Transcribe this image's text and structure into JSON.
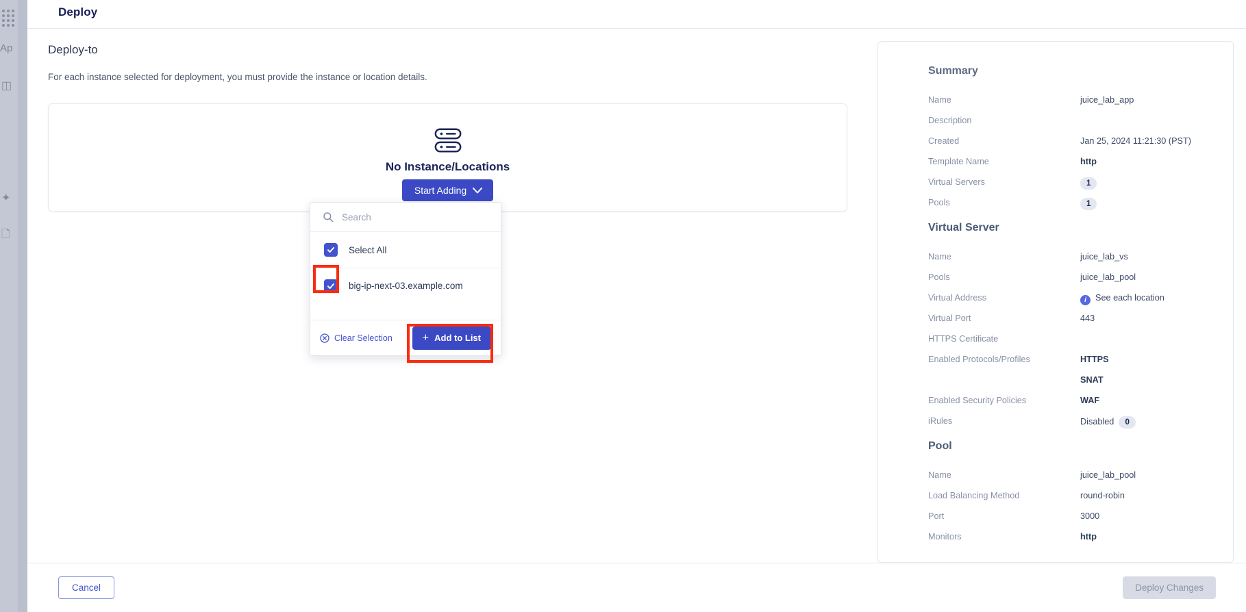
{
  "background": {
    "app_label": "Ap",
    "icons": [
      "grid-dots-icon",
      "cubes-icon",
      "sparkle-icon",
      "document-icon"
    ]
  },
  "modal": {
    "title": "Deploy"
  },
  "deploy_to": {
    "section_title": "Deploy-to",
    "description": "For each instance selected for deployment, you must provide the instance or location details.",
    "empty_state": {
      "title": "No Instance/Locations",
      "button_label": "Start Adding"
    }
  },
  "dropdown": {
    "search_placeholder": "Search",
    "search_value": "",
    "select_all_label": "Select All",
    "items": [
      {
        "label": "big-ip-next-03.example.com",
        "checked": true
      }
    ],
    "clear_label": "Clear Selection",
    "add_label": "Add to List"
  },
  "summary": {
    "heading": "Summary",
    "rows": [
      {
        "key": "Name",
        "value": "juice_lab_app",
        "type": "text"
      },
      {
        "key": "Description",
        "value": "",
        "type": "text"
      },
      {
        "key": "Created",
        "value": "Jan 25, 2024 11:21:30 (PST)",
        "type": "text"
      },
      {
        "key": "Template Name",
        "value": "http",
        "type": "text"
      },
      {
        "key": "Virtual Servers",
        "value": "1",
        "type": "badge"
      },
      {
        "key": "Pools",
        "value": "1",
        "type": "badge"
      }
    ]
  },
  "virtual_server": {
    "heading": "Virtual Server",
    "rows": [
      {
        "key": "Name",
        "value": "juice_lab_vs",
        "type": "text"
      },
      {
        "key": "Pools",
        "value": "juice_lab_pool",
        "type": "text"
      },
      {
        "key": "Virtual Address",
        "value": "See each location",
        "type": "info"
      },
      {
        "key": "Virtual Port",
        "value": "443",
        "type": "text"
      },
      {
        "key": "HTTPS Certificate",
        "value": "",
        "type": "text"
      },
      {
        "key": "Enabled Protocols/Profiles",
        "value": "HTTPS",
        "type": "text"
      },
      {
        "key": "",
        "value": "SNAT",
        "type": "text"
      },
      {
        "key": "Enabled Security Policies",
        "value": "WAF",
        "type": "text"
      },
      {
        "key": "iRules",
        "value": "Disabled",
        "type": "text_badge",
        "badge": "0"
      }
    ]
  },
  "pool": {
    "heading": "Pool",
    "rows": [
      {
        "key": "Name",
        "value": "juice_lab_pool",
        "type": "text"
      },
      {
        "key": "Load Balancing Method",
        "value": "round-robin",
        "type": "text"
      },
      {
        "key": "Port",
        "value": "3000",
        "type": "text"
      },
      {
        "key": "Monitors",
        "value": "http",
        "type": "text"
      }
    ]
  },
  "footer": {
    "cancel_label": "Cancel",
    "deploy_label": "Deploy Changes"
  },
  "colors": {
    "primary": "#3b49c4",
    "accent_link": "#4353cf",
    "highlight": "#f92c12",
    "title": "#1b1f57"
  }
}
